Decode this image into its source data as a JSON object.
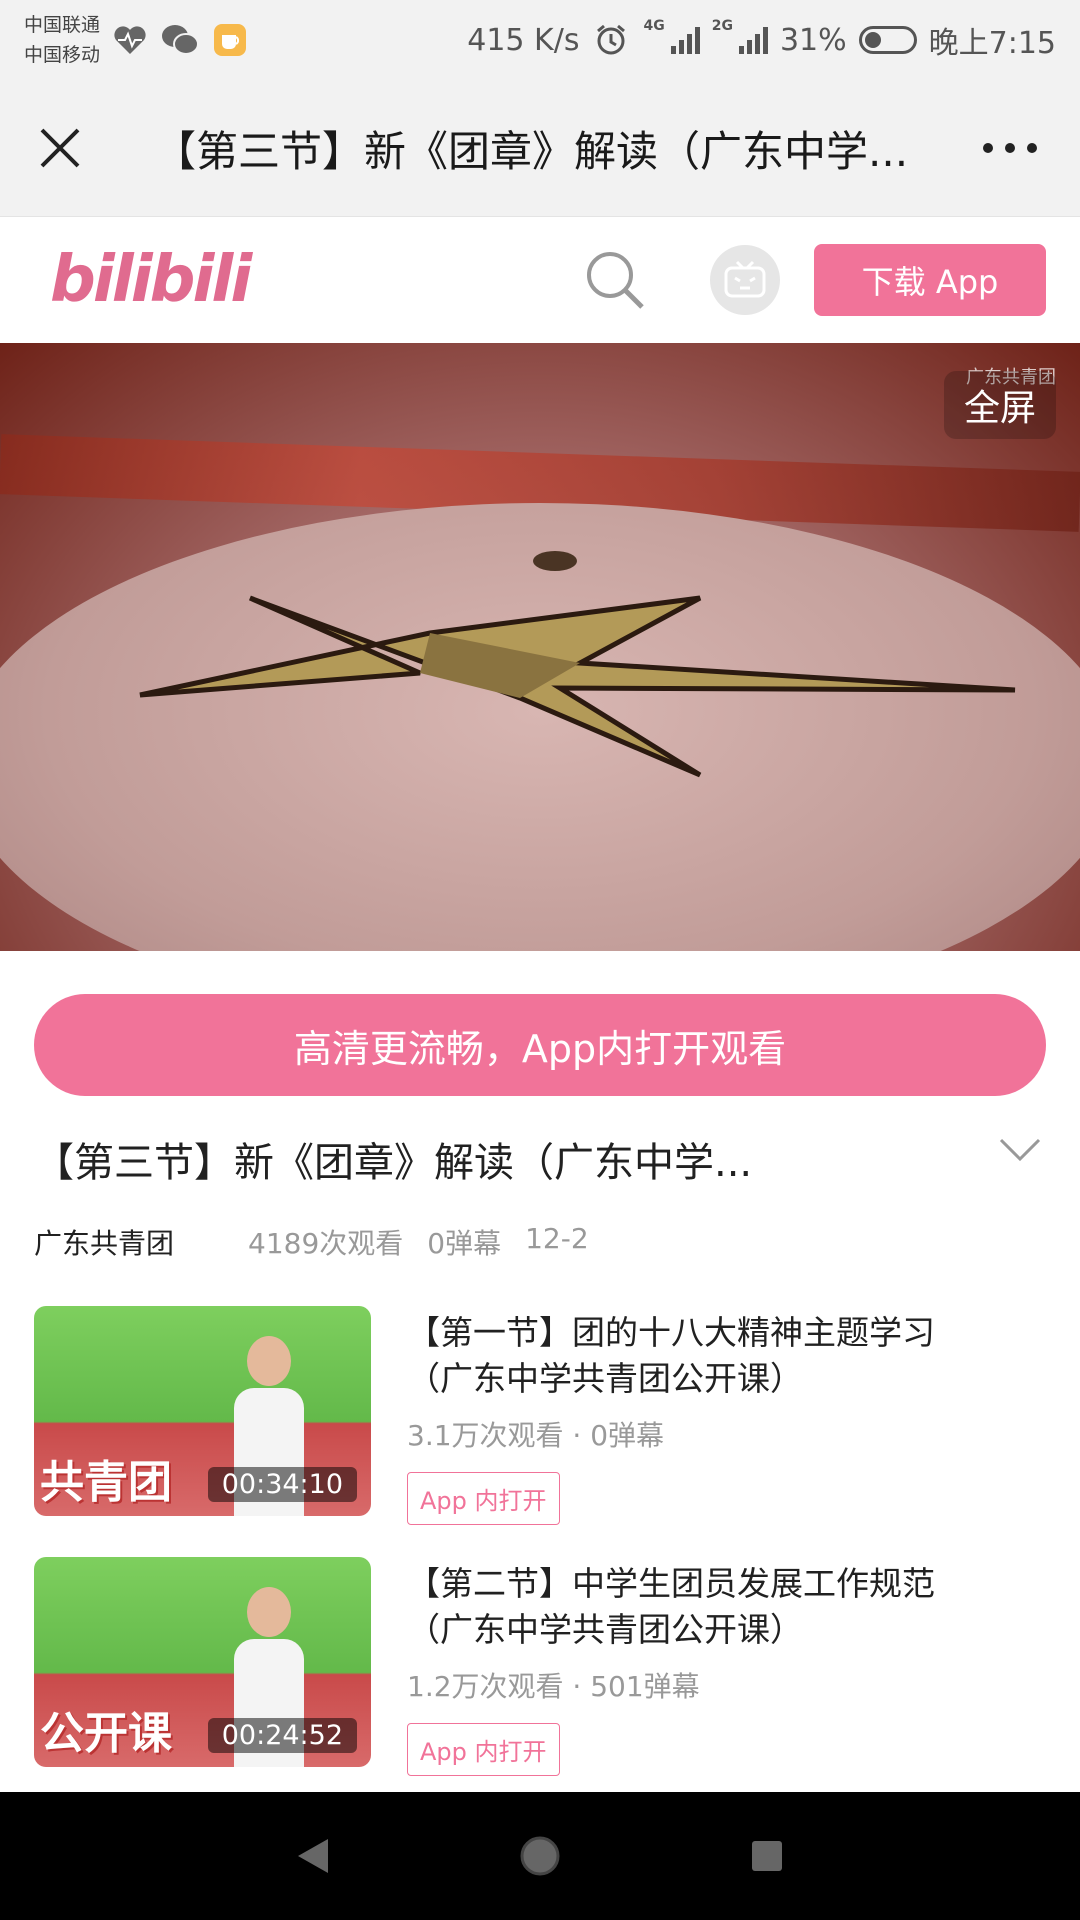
{
  "status_bar": {
    "carrier_1": "中国联通",
    "carrier_2": "中国移动",
    "net_speed": "415 K/s",
    "net_tag_1": "4G",
    "net_tag_2": "2G",
    "battery": "31%",
    "time": "晚上7:15",
    "icons": [
      "heart-monitor-icon",
      "wechat-icon",
      "app-cup-icon",
      "alarm-icon"
    ]
  },
  "title_bar": {
    "title": "【第三节】新《团章》解读（广东中学...",
    "close_icon": "close-icon",
    "more_icon": "more-dots-icon"
  },
  "header": {
    "logo": "bilibili",
    "download_label": "下载 App",
    "search_icon": "search-icon",
    "avatar_icon": "tv-avatar-icon",
    "accent": "#f17399"
  },
  "video": {
    "watermark": "广东共青团",
    "fullscreen_label": "全屏"
  },
  "open_app_label": "高清更流畅，App内打开观看",
  "video_info": {
    "title": "【第三节】新《团章》解读（广东中学...",
    "author": "广东共青团",
    "views": "4189次观看",
    "danmaku": "0弹幕",
    "date": "12-2"
  },
  "related": [
    {
      "title_line1": "【第一节】团的十八大精神主题学习",
      "title_line2": "（广东中学共青团公开课）",
      "stats": "3.1万次观看 · 0弹幕",
      "duration": "00:34:10",
      "thumb_label": "共青团",
      "open_label": "App 内打开"
    },
    {
      "title_line1": "【第二节】中学生团员发展工作规范",
      "title_line2": "（广东中学共青团公开课）",
      "stats": "1.2万次观看 · 501弹幕",
      "duration": "00:24:52",
      "thumb_label": "公开课",
      "open_label": "App 内打开"
    }
  ],
  "nav_bar": {
    "icons": [
      "back-triangle-icon",
      "home-circle-icon",
      "recents-square-icon"
    ]
  }
}
